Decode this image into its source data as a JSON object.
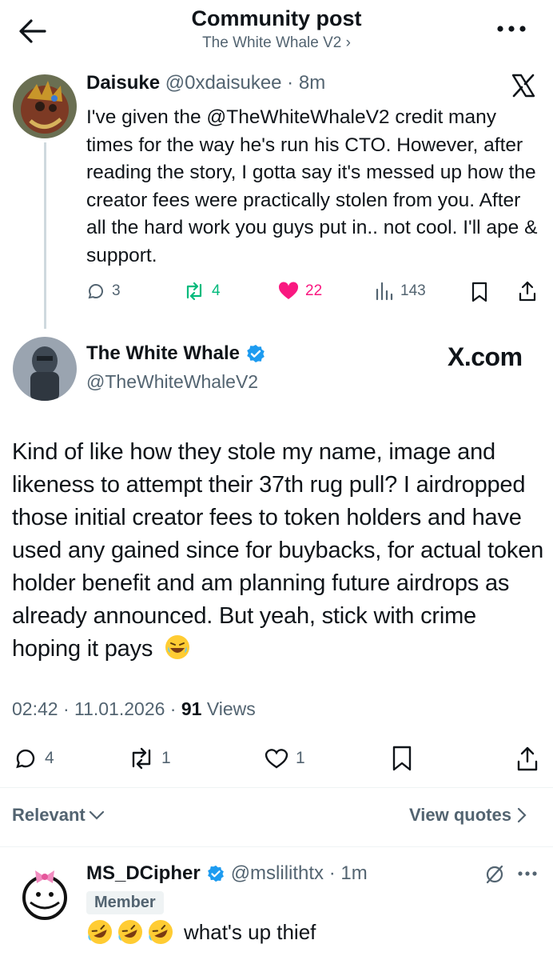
{
  "header": {
    "title": "Community post",
    "subtitle": "The White Whale V2 ›"
  },
  "parent_tweet": {
    "name": "Daisuke",
    "handle_time": "@0xdaisukee · 8m",
    "text": "I've given the @TheWhiteWhaleV2 credit many times for the way he's run his CTO. However, after reading the story, I gotta say it's messed up how the creator fees were practically stolen from you. After all the hard work you guys put in.. not cool. I'll ape & support.",
    "replies": "3",
    "reposts": "4",
    "likes": "22",
    "views": "143"
  },
  "main_tweet": {
    "name": "The White Whale",
    "handle": "@TheWhiteWhaleV2",
    "source_label": "X.com",
    "text": "Kind of like how they stole my name, image and likeness to attempt their 37th rug pull? I airdropped those initial creator fees to token holders and have used any gained since for buybacks, for actual token holder benefit and am planning future airdrops as already announced. But yeah, stick with crime hoping it pays",
    "timestamp": "02:42 · 11.01.2026 · ",
    "views_count": "91",
    "views_label": " Views",
    "replies": "4",
    "reposts": "1",
    "likes": "1"
  },
  "sort": {
    "label": "Relevant",
    "view_quotes": "View quotes"
  },
  "reply": {
    "name": "MS_DCipher",
    "handle_time": "@mslilithtx · 1m",
    "badge": "Member",
    "text": "what's up thief"
  },
  "colors": {
    "green": "#00ba7c",
    "pink": "#f91880",
    "blue": "#1d9bf0",
    "muted": "#536471"
  }
}
